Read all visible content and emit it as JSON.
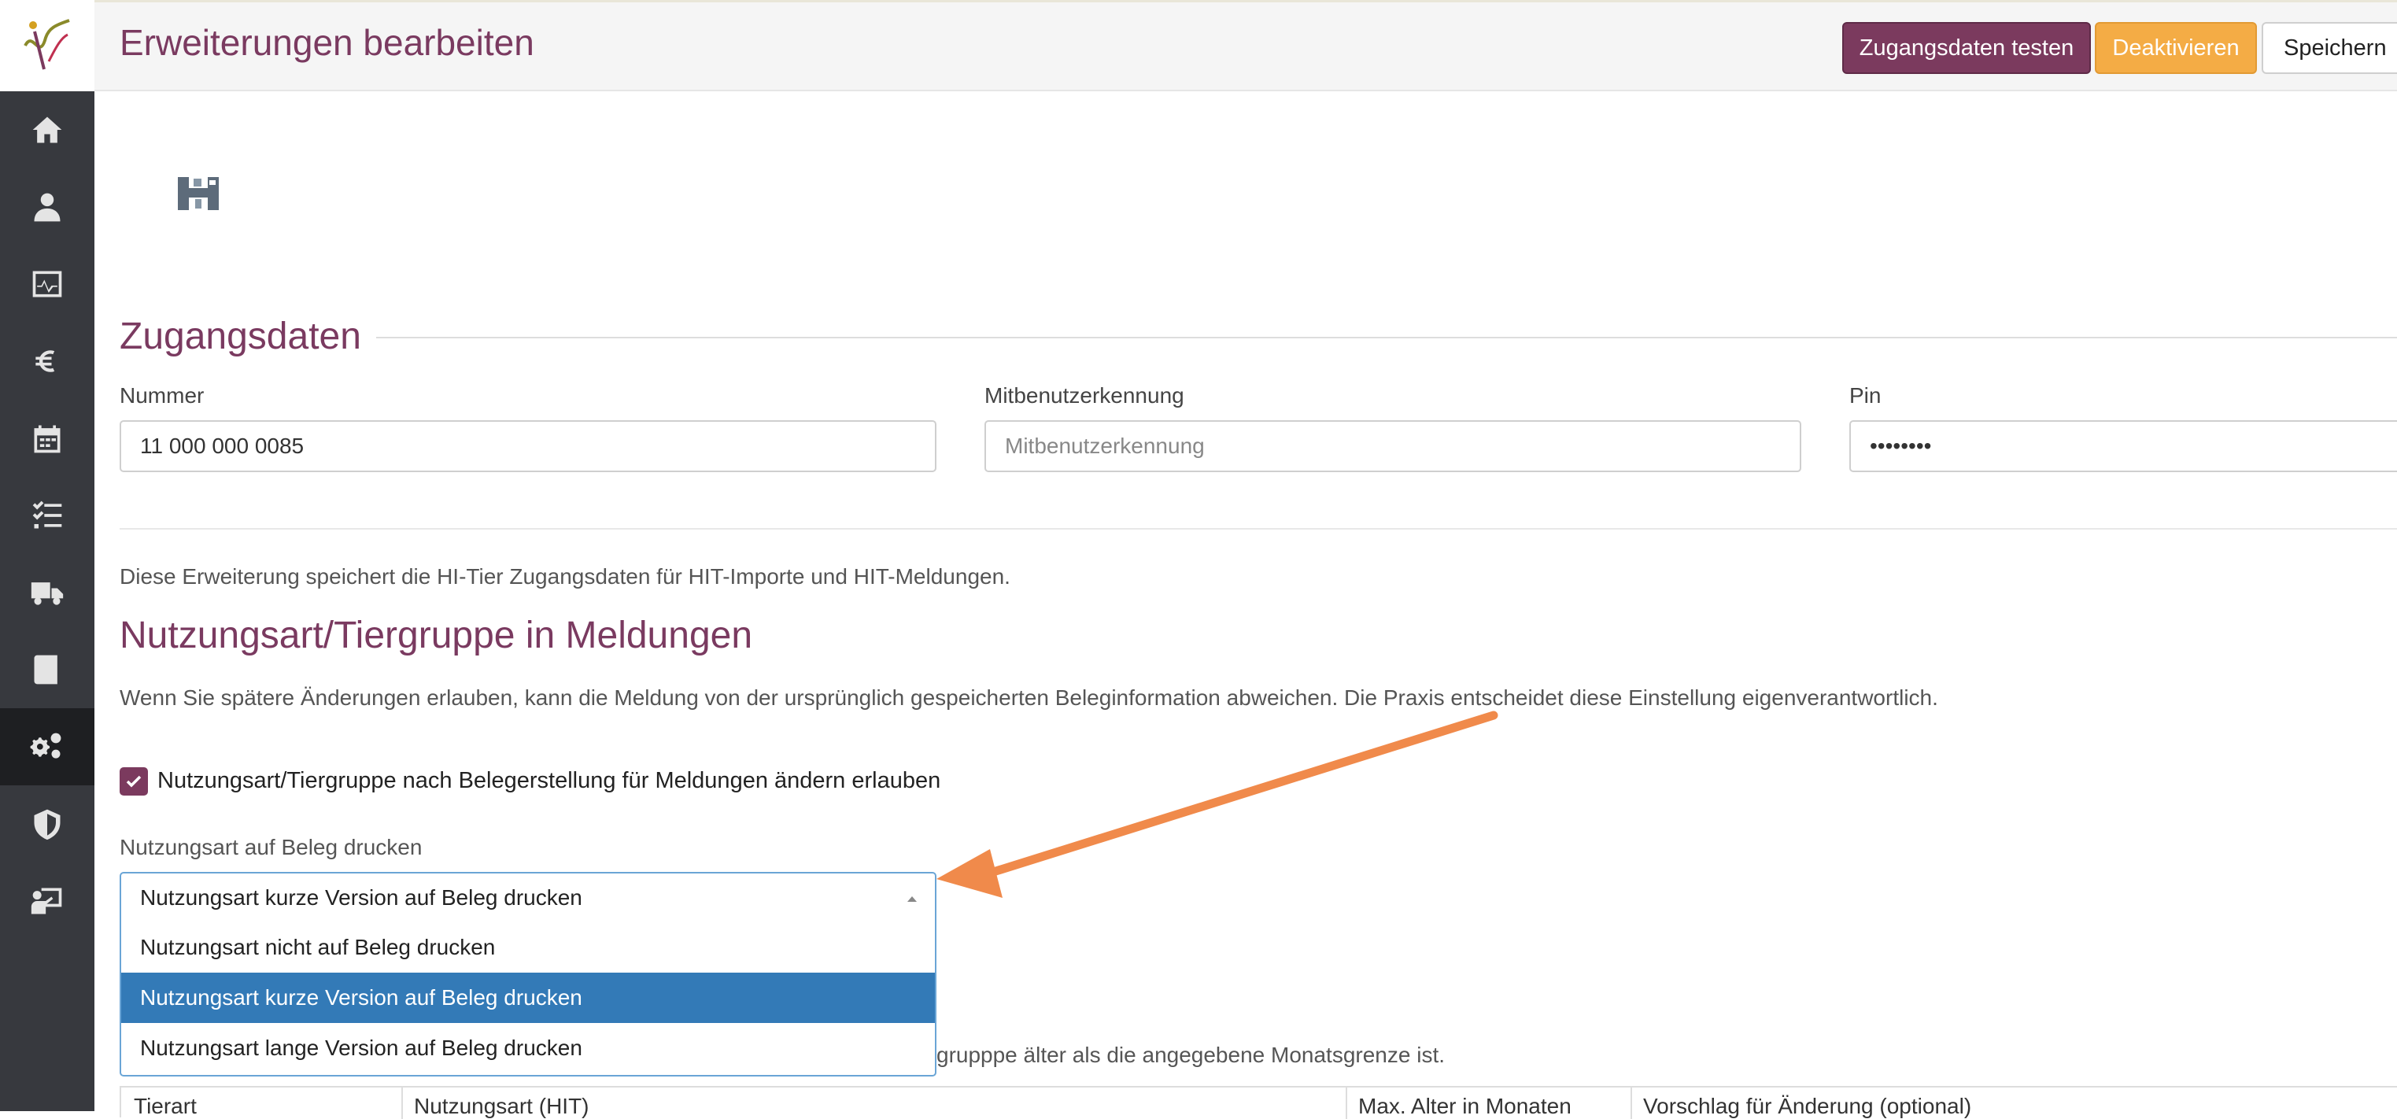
{
  "header": {
    "title": "Erweiterungen bearbeiten",
    "buttons": {
      "test": "Zugangsdaten testen",
      "deactivate": "Deaktivieren",
      "save": "Speichern"
    }
  },
  "sidebar": {
    "items": [
      {
        "icon": "home-icon"
      },
      {
        "icon": "doctor-icon"
      },
      {
        "icon": "monitor-chart-icon"
      },
      {
        "icon": "euro-icon"
      },
      {
        "icon": "calendar-icon"
      },
      {
        "icon": "checklist-icon"
      },
      {
        "icon": "truck-icon"
      },
      {
        "icon": "book-icon"
      },
      {
        "icon": "gears-icon",
        "active": true
      },
      {
        "icon": "shield-icon"
      },
      {
        "icon": "presentation-icon"
      }
    ]
  },
  "credentials": {
    "heading": "Zugangsdaten",
    "number": {
      "label": "Nummer",
      "value": "11 000 000 0085"
    },
    "co_user": {
      "label": "Mitbenutzerkennung",
      "value": "",
      "placeholder": "Mitbenutzerkennung"
    },
    "pin": {
      "label": "Pin",
      "value": "••••••••"
    }
  },
  "info_text": "Diese Erweiterung speichert die HI-Tier Zugangsdaten für HIT-Importe und HIT-Meldungen.",
  "usage": {
    "heading": "Nutzungsart/Tiergruppe in Meldungen",
    "description": "Wenn Sie spätere Änderungen erlauben, kann die Meldung von der ursprünglich gespeicherten Beleginformation abweichen. Die Praxis entscheidet diese Einstellung eigenverantwortlich.",
    "checkbox_label": "Nutzungsart/Tiergruppe nach Belegerstellung für Meldungen ändern erlauben",
    "checkbox_checked": true,
    "print_label": "Nutzungsart auf Beleg drucken",
    "selected": "Nutzungsart kurze Version auf Beleg drucken",
    "options": [
      "Nutzungsart nicht auf Beleg drucken",
      "Nutzungsart kurze Version auf Beleg drucken",
      "Nutzungsart lange Version auf Beleg drucken"
    ],
    "selected_index": 1,
    "partial_text": "grupppe älter als die angegebene Monatsgrenze ist."
  },
  "table": {
    "headers": [
      "Tierart",
      "Nutzungsart (HIT)",
      "Max. Alter in Monaten",
      "Vorschlag für Änderung (optional)"
    ]
  },
  "colors": {
    "brand": "#7b3a5e",
    "warning": "#f4ac45",
    "selection": "#337ab7",
    "annotation_arrow": "#f08a4b"
  }
}
